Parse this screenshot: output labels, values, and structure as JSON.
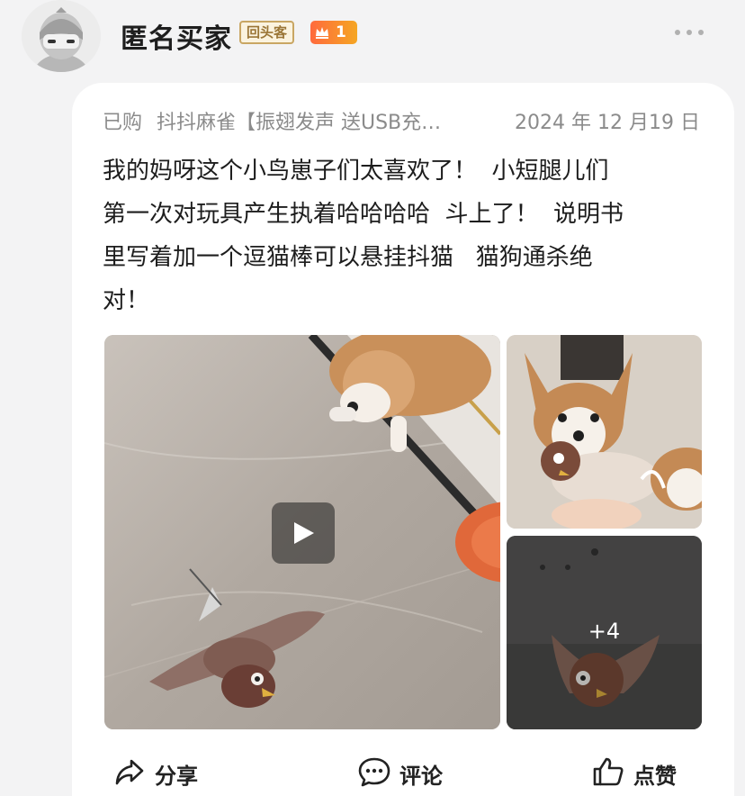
{
  "user": {
    "name": "匿名买家",
    "badge": "回头客",
    "level": "1"
  },
  "review": {
    "purchased_label": "已购",
    "product_name": "抖抖麻雀【振翅发声 送USB充…",
    "date": "2024 年 12 月19 日",
    "text": "我的妈呀这个小鸟崽子们太喜欢了！  小短腿儿们\n第一次对玩具产生执着哈哈哈哈  斗上了！  说明书\n里写着加一个逗猫棒可以悬挂抖猫   猫狗通杀绝\n对！"
  },
  "media": {
    "more_count": "+4"
  },
  "actions": {
    "share": "分享",
    "comment": "评论",
    "like": "点赞"
  },
  "icons": {
    "more": "more-dots-icon",
    "share": "share-arrow-icon",
    "comment": "comment-bubble-icon",
    "like": "thumbs-up-icon",
    "play": "play-icon",
    "crown": "crown-icon"
  },
  "colors": {
    "background": "#f3f3f4",
    "card": "#ffffff",
    "muted_text": "#8b8b8b",
    "badge_border": "#c9a663",
    "level_badge": "#ff6a3d"
  }
}
